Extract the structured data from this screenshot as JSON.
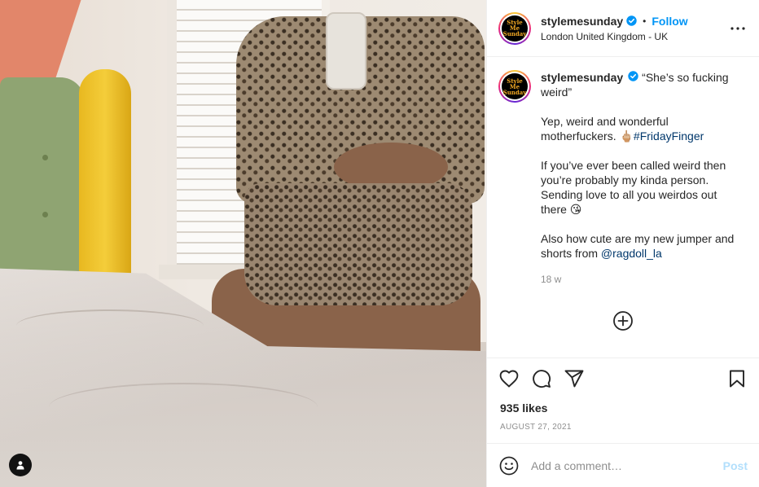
{
  "header": {
    "username": "stylemesunday",
    "dot": "•",
    "follow_label": "Follow",
    "location": "London United Kingdom - UK",
    "avatar_text": "Style Me Sunday"
  },
  "caption": {
    "username": "stylemesunday",
    "line1": "“She’s so fucking weird”",
    "p2_text": "Yep, weird and wonderful motherfuckers. 🖕🏼",
    "p2_hashtag": "#FridayFinger",
    "p3": "If you’ve ever been called weird then you’re probably my kinda person. Sending love to all you weirdos out there 😘",
    "p4_text": "Also how cute are my new jumper and shorts from ",
    "p4_mention": "@ragdoll_la",
    "age": "18 w"
  },
  "likes": "935 likes",
  "date": "AUGUST 27, 2021",
  "comment_box": {
    "placeholder": "Add a comment…",
    "post_label": "Post"
  },
  "colors": {
    "accent": "#0095f6",
    "post_disabled": "#b2dffc",
    "verified": "#0095f6"
  },
  "icons": [
    "verified-badge-icon",
    "more-options-icon",
    "load-more-comments-icon",
    "heart-icon",
    "comment-icon",
    "share-icon",
    "bookmark-icon",
    "emoji-icon",
    "user-tag-icon"
  ]
}
